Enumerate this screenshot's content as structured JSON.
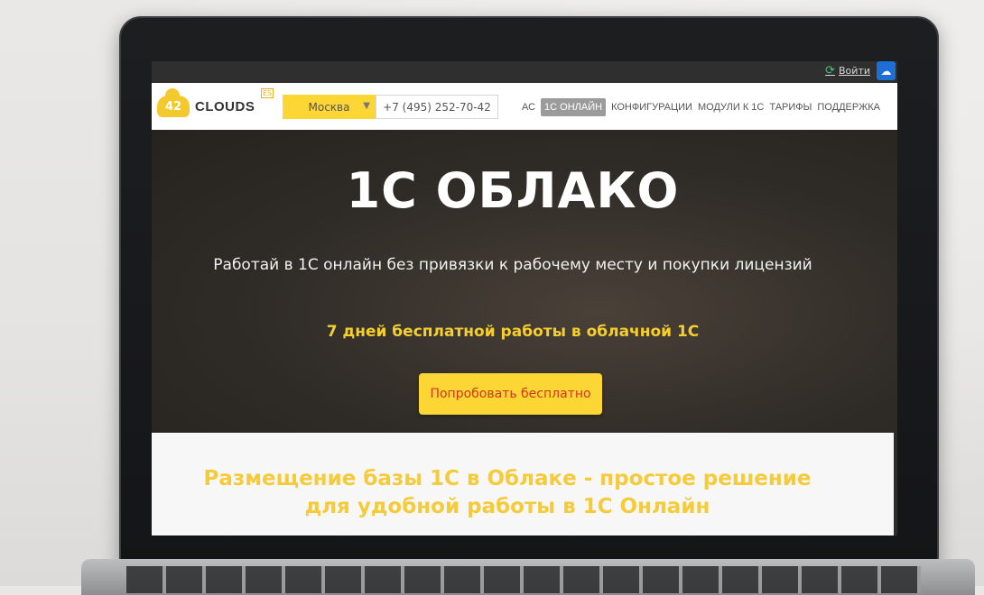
{
  "topbar": {
    "login_label": "Войти"
  },
  "header": {
    "logo_number": "42",
    "logo_text": "CLOUDS",
    "logo_badge": "ES",
    "city": "Москва",
    "phone": "+7 (495) 252-70-42"
  },
  "nav": {
    "items": [
      {
        "label": "АС",
        "active": false
      },
      {
        "label": "1С ОНЛАЙН",
        "active": true
      },
      {
        "label": "КОНФИГУРАЦИИ",
        "active": false
      },
      {
        "label": "МОДУЛИ К 1С",
        "active": false
      },
      {
        "label": "ТАРИФЫ",
        "active": false
      },
      {
        "label": "ПОДДЕРЖКА",
        "active": false
      }
    ]
  },
  "hero": {
    "title": "1С ОБЛАКО",
    "subtitle": "Работай в 1С онлайн без привязки к рабочему месту и покупки лицензий",
    "promo": "7 дней бесплатной работы в облачной 1С",
    "cta_label": "Попробовать бесплатно"
  },
  "section": {
    "title_line1": "Размещение базы 1С в Облаке - простое решение",
    "title_line2": "для удобной работы в 1С Онлайн"
  },
  "colors": {
    "accent_yellow": "#fbd634",
    "cta_text": "#d3361a",
    "section_title": "#f6cb3b"
  }
}
